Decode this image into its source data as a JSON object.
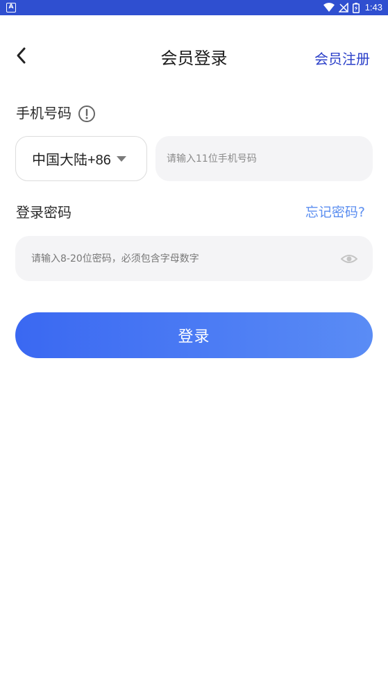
{
  "status_bar": {
    "app_icon_letter": "A",
    "time": "1:43",
    "bg_color": "#2f4fd0"
  },
  "header": {
    "title": "会员登录",
    "register_label": "会员注册",
    "back_icon": "chevron-left-icon"
  },
  "phone": {
    "label": "手机号码",
    "info_icon": "info-circle-icon",
    "country_code": "中国大陆+86",
    "placeholder": "请输入11位手机号码"
  },
  "password": {
    "label": "登录密码",
    "forgot_label": "忘记密码?",
    "placeholder": "请输入8-20位密码，必须包含字母数字",
    "visibility_icon": "eye-icon"
  },
  "login_button": {
    "label": "登录",
    "gradient": [
      "#3a68f2",
      "#5a8cf5"
    ]
  },
  "colors": {
    "accent": "#2a3fc9",
    "link": "#5b8ef0",
    "field_bg": "#f4f4f6"
  }
}
